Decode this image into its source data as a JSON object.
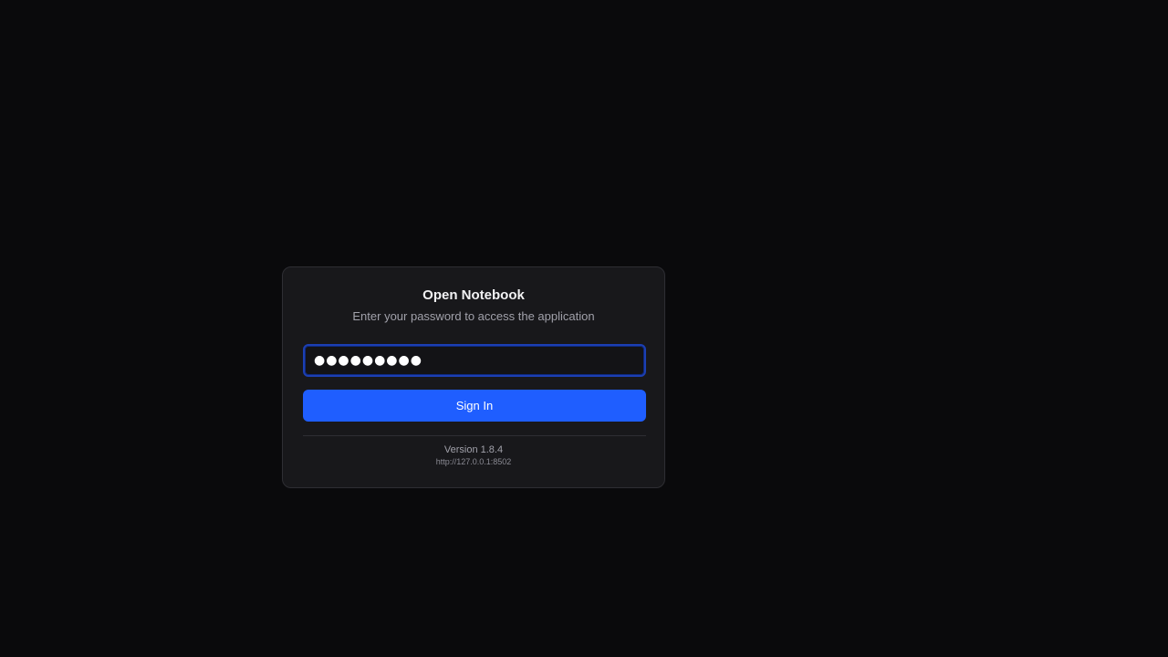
{
  "login": {
    "title": "Open Notebook",
    "subtitle": "Enter your password to access the application",
    "password_value": "●●●●●●●●●",
    "sign_in_label": "Sign In",
    "version": "Version 1.8.4",
    "server_url": "http://127.0.0.1:8502"
  },
  "colors": {
    "background": "#0a0a0c",
    "card": "#18181b",
    "accent": "#1f5eff",
    "focus_ring": "#1c3fb3"
  }
}
